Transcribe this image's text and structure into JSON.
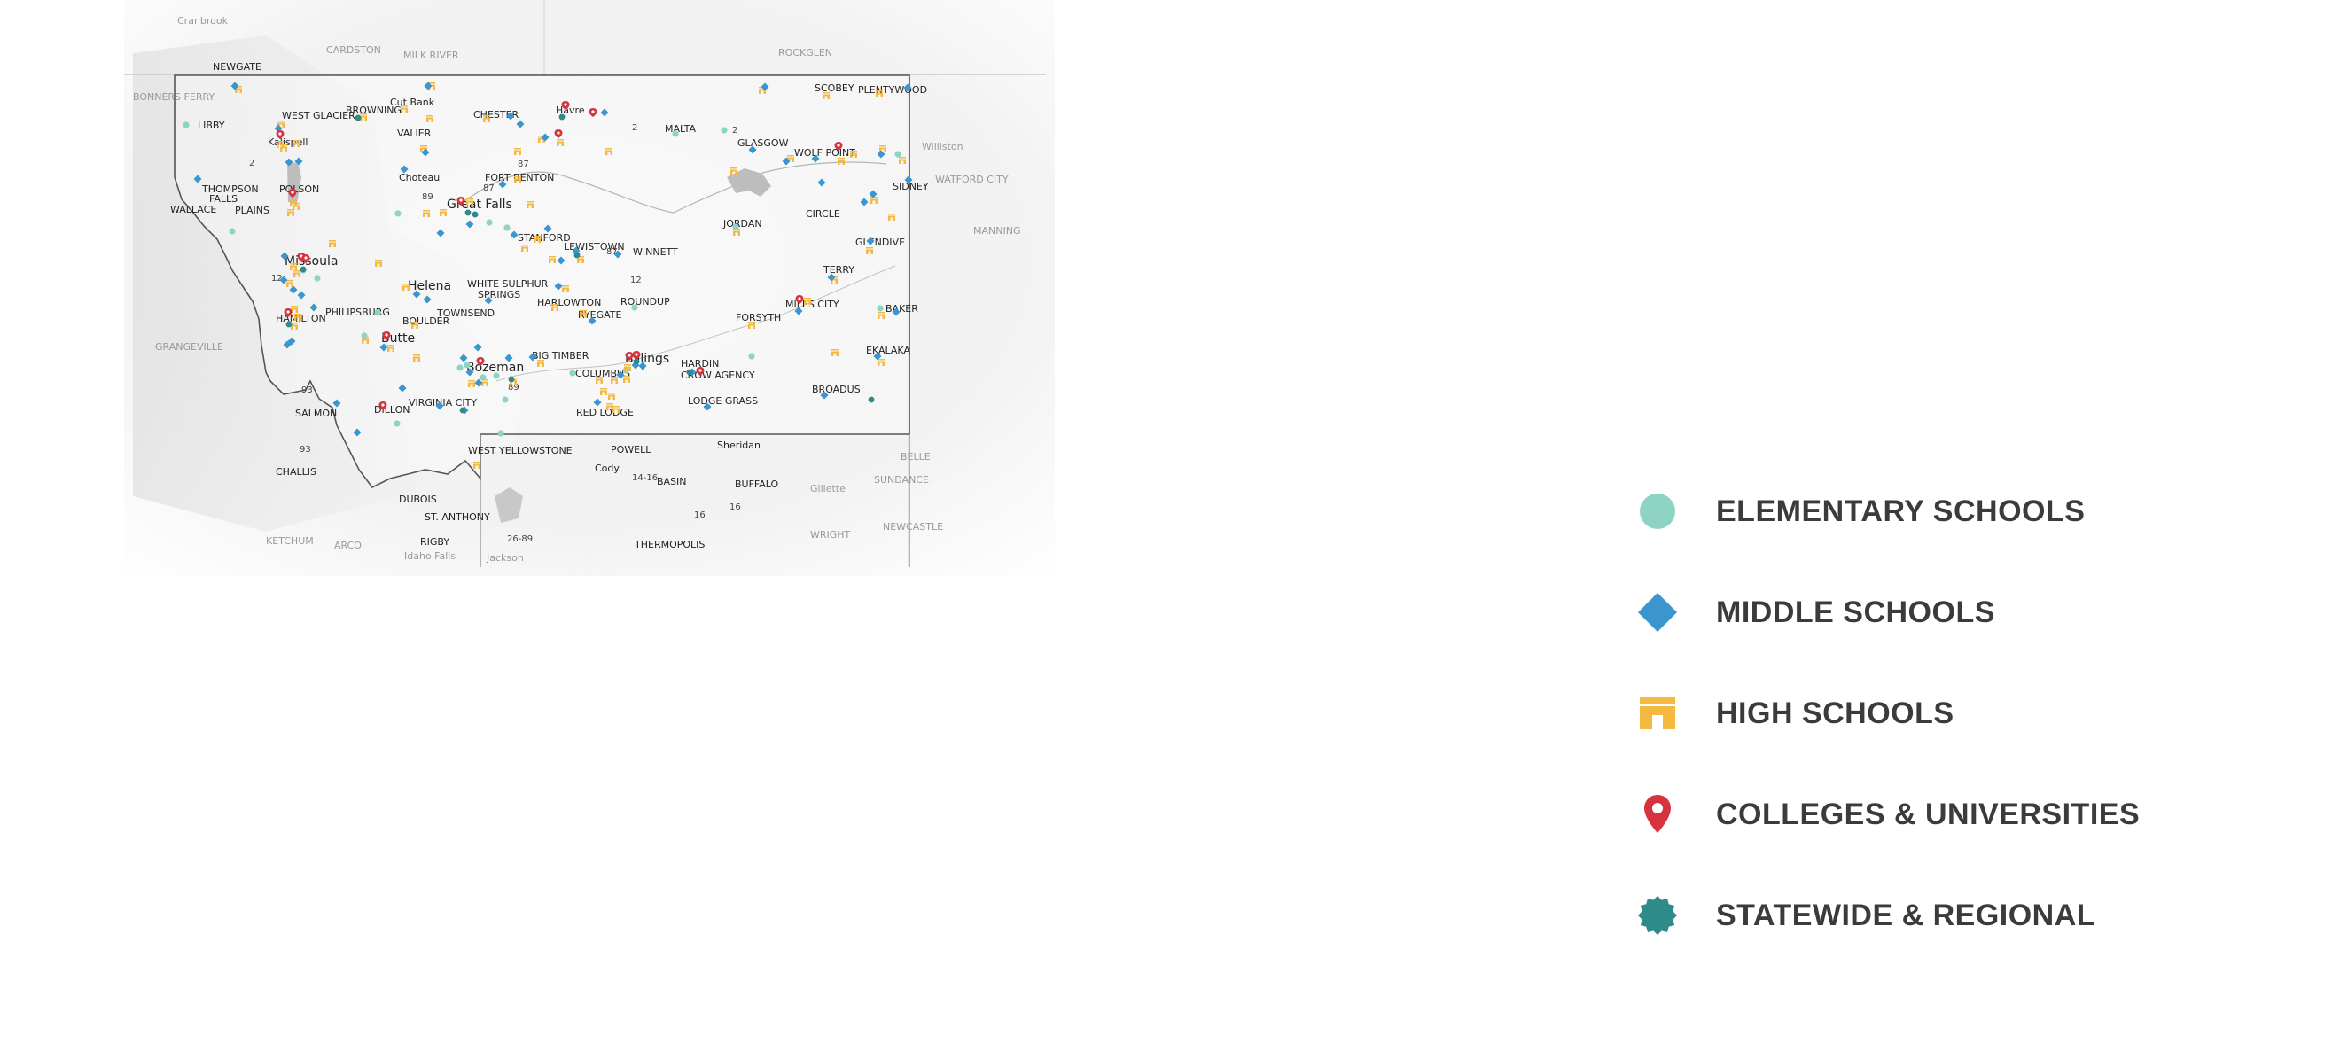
{
  "legend": {
    "items": [
      {
        "key": "elementary",
        "label": "ELEMENTARY SCHOOLS",
        "color": "#8fd3c4",
        "shape": "circle"
      },
      {
        "key": "middle",
        "label": "MIDDLE SCHOOLS",
        "color": "#3b95cf",
        "shape": "diamond"
      },
      {
        "key": "high",
        "label": "HIGH SCHOOLS",
        "color": "#f5b942",
        "shape": "school"
      },
      {
        "key": "college",
        "label": "COLLEGES & UNIVERSITIES",
        "color": "#d6333f",
        "shape": "pin"
      },
      {
        "key": "statewide",
        "label": "STATEWIDE & REGIONAL",
        "color": "#2f8a8a",
        "shape": "badge"
      }
    ]
  },
  "places": [
    {
      "name": "Cranbrook",
      "style": "grey"
    },
    {
      "name": "NEWGATE",
      "style": "normal"
    },
    {
      "name": "CARDSTON",
      "style": "grey"
    },
    {
      "name": "MILK RIVER",
      "style": "grey"
    },
    {
      "name": "ROCKGLEN",
      "style": "grey"
    },
    {
      "name": "BONNERS FERRY",
      "style": "grey"
    },
    {
      "name": "BROWNING",
      "style": "normal"
    },
    {
      "name": "Cut Bank",
      "style": "normal"
    },
    {
      "name": "WEST GLACIER",
      "style": "normal"
    },
    {
      "name": "CHESTER",
      "style": "normal"
    },
    {
      "name": "Havre",
      "style": "normal"
    },
    {
      "name": "SCOBEY",
      "style": "normal"
    },
    {
      "name": "PLENTYWOOD",
      "style": "normal"
    },
    {
      "name": "LIBBY",
      "style": "normal"
    },
    {
      "name": "Kalispell",
      "style": "normal"
    },
    {
      "name": "VALIER",
      "style": "normal"
    },
    {
      "name": "MALTA",
      "style": "normal"
    },
    {
      "name": "GLASGOW",
      "style": "normal"
    },
    {
      "name": "WOLF POINT",
      "style": "normal"
    },
    {
      "name": "Williston",
      "style": "grey"
    },
    {
      "name": "Choteau",
      "style": "normal"
    },
    {
      "name": "FORT BENTON",
      "style": "normal"
    },
    {
      "name": "THOMPSON FALLS",
      "style": "normal"
    },
    {
      "name": "POLSON",
      "style": "normal"
    },
    {
      "name": "SIDNEY",
      "style": "normal"
    },
    {
      "name": "WATFORD CITY",
      "style": "grey"
    },
    {
      "name": "WALLACE",
      "style": "normal"
    },
    {
      "name": "PLAINS",
      "style": "normal"
    },
    {
      "name": "Great Falls",
      "style": "big"
    },
    {
      "name": "CIRCLE",
      "style": "normal"
    },
    {
      "name": "JORDAN",
      "style": "normal"
    },
    {
      "name": "STANFORD",
      "style": "normal"
    },
    {
      "name": "LEWISTOWN",
      "style": "normal"
    },
    {
      "name": "WINNETT",
      "style": "normal"
    },
    {
      "name": "GLENDIVE",
      "style": "normal"
    },
    {
      "name": "Missoula",
      "style": "big"
    },
    {
      "name": "Helena",
      "style": "big"
    },
    {
      "name": "WHITE SULPHUR SPRINGS",
      "style": "normal"
    },
    {
      "name": "TERRY",
      "style": "normal"
    },
    {
      "name": "PHILIPSBURG",
      "style": "normal"
    },
    {
      "name": "HARLOWTON",
      "style": "normal"
    },
    {
      "name": "ROUNDUP",
      "style": "normal"
    },
    {
      "name": "MILES CITY",
      "style": "normal"
    },
    {
      "name": "BAKER",
      "style": "normal"
    },
    {
      "name": "HAMILTON",
      "style": "normal"
    },
    {
      "name": "BOULDER",
      "style": "normal"
    },
    {
      "name": "TOWNSEND",
      "style": "normal"
    },
    {
      "name": "RYEGATE",
      "style": "normal"
    },
    {
      "name": "FORSYTH",
      "style": "normal"
    },
    {
      "name": "GRANGEVILLE",
      "style": "grey"
    },
    {
      "name": "Butte",
      "style": "big"
    },
    {
      "name": "Bozeman",
      "style": "big"
    },
    {
      "name": "BIG TIMBER",
      "style": "normal"
    },
    {
      "name": "Billings",
      "style": "big"
    },
    {
      "name": "HARDIN",
      "style": "normal"
    },
    {
      "name": "CROW AGENCY",
      "style": "normal"
    },
    {
      "name": "EKALAKA",
      "style": "normal"
    },
    {
      "name": "COLUMBUS",
      "style": "normal"
    },
    {
      "name": "BROADUS",
      "style": "normal"
    },
    {
      "name": "DILLON",
      "style": "normal"
    },
    {
      "name": "VIRGINIA CITY",
      "style": "normal"
    },
    {
      "name": "LODGE GRASS",
      "style": "normal"
    },
    {
      "name": "SALMON",
      "style": "normal"
    },
    {
      "name": "RED LODGE",
      "style": "normal"
    },
    {
      "name": "WEST YELLOWSTONE",
      "style": "normal"
    },
    {
      "name": "POWELL",
      "style": "normal"
    },
    {
      "name": "Sheridan",
      "style": "normal"
    },
    {
      "name": "Cody",
      "style": "normal"
    },
    {
      "name": "CHALLIS",
      "style": "normal"
    },
    {
      "name": "BASIN",
      "style": "normal"
    },
    {
      "name": "BUFFALO",
      "style": "normal"
    },
    {
      "name": "Gillette",
      "style": "grey"
    },
    {
      "name": "SUNDANCE",
      "style": "grey"
    },
    {
      "name": "DUBOIS",
      "style": "normal"
    },
    {
      "name": "ST. ANTHONY",
      "style": "normal"
    },
    {
      "name": "THERMOPOLIS",
      "style": "normal"
    },
    {
      "name": "WRIGHT",
      "style": "grey"
    },
    {
      "name": "NEWCASTLE",
      "style": "grey"
    },
    {
      "name": "KETCHUM",
      "style": "grey"
    },
    {
      "name": "ARCO",
      "style": "grey"
    },
    {
      "name": "RIGBY",
      "style": "normal"
    },
    {
      "name": "Idaho Falls",
      "style": "grey"
    },
    {
      "name": "Jackson",
      "style": "grey"
    },
    {
      "name": "MANNING",
      "style": "grey"
    },
    {
      "name": "BELLE",
      "style": "grey"
    }
  ],
  "routes": [
    "2",
    "2",
    "2",
    "87",
    "87",
    "89",
    "87",
    "12",
    "93",
    "93",
    "89",
    "14-16",
    "26-89",
    "16",
    "16",
    "12"
  ],
  "schools": {
    "elementary": [
      [
        210,
        141
      ],
      [
        262,
        261
      ],
      [
        358,
        314
      ],
      [
        426,
        353
      ],
      [
        411,
        379
      ],
      [
        449,
        241
      ],
      [
        552,
        251
      ],
      [
        572,
        257
      ],
      [
        527,
        412
      ],
      [
        545,
        426
      ],
      [
        560,
        424
      ],
      [
        570,
        451
      ],
      [
        565,
        489
      ],
      [
        646,
        421
      ],
      [
        716,
        347
      ],
      [
        762,
        151
      ],
      [
        817,
        147
      ],
      [
        830,
        256
      ],
      [
        706,
        418
      ],
      [
        848,
        402
      ],
      [
        993,
        348
      ],
      [
        1013,
        174
      ],
      [
        448,
        478
      ],
      [
        668,
        126
      ],
      [
        342,
        305
      ],
      [
        519,
        415
      ]
    ],
    "middle": [
      [
        265,
        97
      ],
      [
        483,
        97
      ],
      [
        576,
        131
      ],
      [
        587,
        140
      ],
      [
        682,
        127
      ],
      [
        615,
        155
      ],
      [
        314,
        145
      ],
      [
        326,
        183
      ],
      [
        337,
        182
      ],
      [
        223,
        202
      ],
      [
        456,
        191
      ],
      [
        480,
        172
      ],
      [
        567,
        208
      ],
      [
        497,
        263
      ],
      [
        530,
        253
      ],
      [
        580,
        265
      ],
      [
        618,
        258
      ],
      [
        650,
        283
      ],
      [
        633,
        294
      ],
      [
        697,
        287
      ],
      [
        321,
        289
      ],
      [
        320,
        316
      ],
      [
        331,
        327
      ],
      [
        340,
        333
      ],
      [
        354,
        347
      ],
      [
        329,
        385
      ],
      [
        324,
        389
      ],
      [
        470,
        332
      ],
      [
        482,
        338
      ],
      [
        433,
        392
      ],
      [
        454,
        438
      ],
      [
        380,
        455
      ],
      [
        403,
        488
      ],
      [
        496,
        458
      ],
      [
        539,
        392
      ],
      [
        523,
        404
      ],
      [
        530,
        420
      ],
      [
        540,
        432
      ],
      [
        574,
        404
      ],
      [
        601,
        403
      ],
      [
        524,
        463
      ],
      [
        630,
        323
      ],
      [
        551,
        339
      ],
      [
        668,
        362
      ],
      [
        717,
        412
      ],
      [
        700,
        423
      ],
      [
        725,
        413
      ],
      [
        674,
        454
      ],
      [
        798,
        459
      ],
      [
        849,
        169
      ],
      [
        887,
        182
      ],
      [
        863,
        98
      ],
      [
        920,
        179
      ],
      [
        927,
        206
      ],
      [
        985,
        219
      ],
      [
        975,
        228
      ],
      [
        994,
        174
      ],
      [
        1024,
        99
      ],
      [
        1025,
        203
      ],
      [
        938,
        313
      ],
      [
        901,
        351
      ],
      [
        930,
        446
      ],
      [
        982,
        272
      ],
      [
        1011,
        352
      ],
      [
        990,
        402
      ],
      [
        781,
        420
      ]
    ],
    "high": [
      [
        269,
        101
      ],
      [
        487,
        97
      ],
      [
        410,
        132
      ],
      [
        456,
        123
      ],
      [
        485,
        134
      ],
      [
        317,
        140
      ],
      [
        549,
        134
      ],
      [
        611,
        157
      ],
      [
        632,
        161
      ],
      [
        687,
        171
      ],
      [
        320,
        167
      ],
      [
        316,
        163
      ],
      [
        334,
        162
      ],
      [
        331,
        229
      ],
      [
        328,
        240
      ],
      [
        334,
        233
      ],
      [
        481,
        241
      ],
      [
        500,
        240
      ],
      [
        530,
        228
      ],
      [
        598,
        231
      ],
      [
        478,
        168
      ],
      [
        584,
        171
      ],
      [
        584,
        203
      ],
      [
        427,
        297
      ],
      [
        375,
        275
      ],
      [
        331,
        301
      ],
      [
        335,
        309
      ],
      [
        327,
        320
      ],
      [
        332,
        349
      ],
      [
        336,
        358
      ],
      [
        332,
        368
      ],
      [
        458,
        324
      ],
      [
        468,
        367
      ],
      [
        412,
        384
      ],
      [
        441,
        393
      ],
      [
        470,
        404
      ],
      [
        532,
        433
      ],
      [
        547,
        432
      ],
      [
        579,
        430
      ],
      [
        610,
        410
      ],
      [
        623,
        293
      ],
      [
        592,
        280
      ],
      [
        606,
        270
      ],
      [
        655,
        293
      ],
      [
        638,
        326
      ],
      [
        626,
        347
      ],
      [
        658,
        354
      ],
      [
        676,
        429
      ],
      [
        693,
        429
      ],
      [
        681,
        442
      ],
      [
        690,
        447
      ],
      [
        688,
        459
      ],
      [
        695,
        462
      ],
      [
        707,
        428
      ],
      [
        708,
        415
      ],
      [
        538,
        525
      ],
      [
        860,
        102
      ],
      [
        932,
        108
      ],
      [
        992,
        106
      ],
      [
        1018,
        181
      ],
      [
        963,
        174
      ],
      [
        949,
        182
      ],
      [
        892,
        179
      ],
      [
        996,
        168
      ],
      [
        986,
        226
      ],
      [
        1006,
        245
      ],
      [
        981,
        283
      ],
      [
        994,
        356
      ],
      [
        941,
        316
      ],
      [
        911,
        340
      ],
      [
        848,
        367
      ],
      [
        831,
        262
      ],
      [
        828,
        193
      ],
      [
        942,
        398
      ],
      [
        994,
        409
      ]
    ],
    "college": [
      [
        316,
        156
      ],
      [
        330,
        222
      ],
      [
        340,
        294
      ],
      [
        345,
        296
      ],
      [
        325,
        357
      ],
      [
        436,
        383
      ],
      [
        432,
        462
      ],
      [
        638,
        123
      ],
      [
        669,
        131
      ],
      [
        630,
        155
      ],
      [
        946,
        169
      ],
      [
        902,
        342
      ],
      [
        718,
        405
      ],
      [
        710,
        406
      ],
      [
        790,
        423
      ],
      [
        542,
        412
      ],
      [
        520,
        231
      ]
    ],
    "statewide": [
      [
        404,
        133
      ],
      [
        634,
        132
      ],
      [
        528,
        240
      ],
      [
        536,
        242
      ],
      [
        342,
        304
      ],
      [
        326,
        366
      ],
      [
        718,
        408
      ],
      [
        522,
        463
      ],
      [
        577,
        428
      ],
      [
        651,
        288
      ],
      [
        778,
        420
      ],
      [
        983,
        451
      ]
    ]
  }
}
